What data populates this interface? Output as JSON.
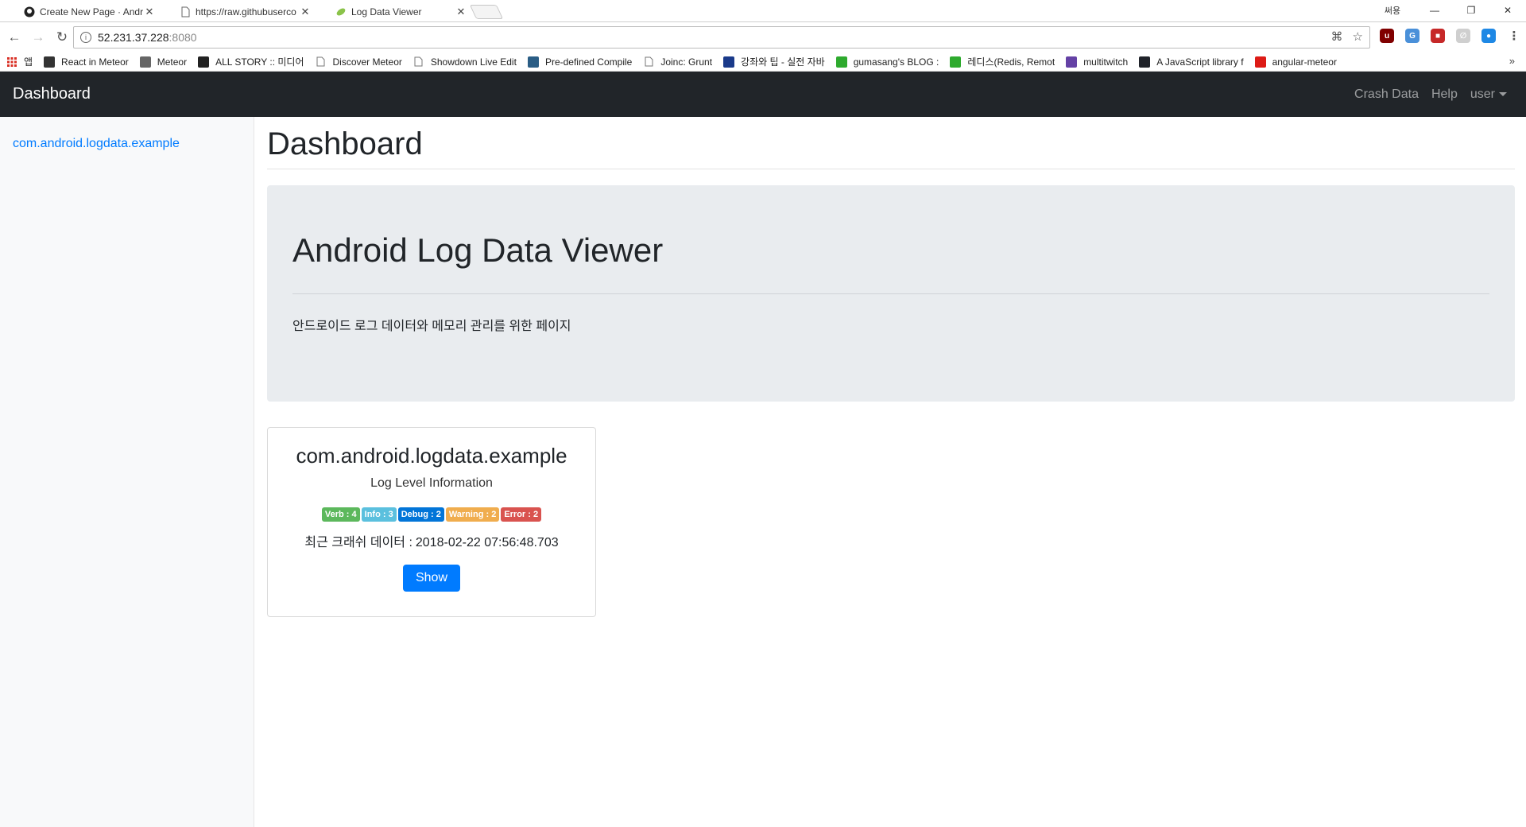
{
  "browser": {
    "tabs": [
      {
        "title": "Create New Page · Andr",
        "icon": "github-icon",
        "active": false
      },
      {
        "title": "https://raw.githubuserco",
        "icon": "page-icon",
        "active": false
      },
      {
        "title": "Log Data Viewer",
        "icon": "leaf-icon",
        "active": true
      }
    ],
    "profile_label": "써용",
    "url_host": "52.231.37.228",
    "url_port": ":8080",
    "bookmarks": [
      {
        "label": "앱",
        "icon": "apps-grid-icon",
        "color": "#d93025"
      },
      {
        "label": "React in Meteor",
        "icon": "book-icon",
        "color": "#333333"
      },
      {
        "label": "Meteor",
        "icon": "meteor-icon",
        "color": "#666666"
      },
      {
        "label": "ALL STORY :: 미디어",
        "icon": "circle-icon",
        "color": "#222222"
      },
      {
        "label": "Discover Meteor",
        "icon": "page-icon",
        "color": "#777777"
      },
      {
        "label": "Showdown Live Edit",
        "icon": "page-icon",
        "color": "#777777"
      },
      {
        "label": "Pre-defined Compile",
        "icon": "sf-icon",
        "color": "#2a5d85"
      },
      {
        "label": "Joinc: Grunt",
        "icon": "page-icon",
        "color": "#777777"
      },
      {
        "label": "강좌와 팁 - 실전 자바",
        "icon": "code-icon",
        "color": "#1a3a8a"
      },
      {
        "label": "gumasang's BLOG :",
        "icon": "blog-icon",
        "color": "#2eaa2e"
      },
      {
        "label": "레디스(Redis, Remot",
        "icon": "blog-icon",
        "color": "#2eaa2e"
      },
      {
        "label": "multitwitch",
        "icon": "twitch-icon",
        "color": "#6441a5"
      },
      {
        "label": "A JavaScript library f",
        "icon": "react-icon",
        "color": "#20232a"
      },
      {
        "label": "angular-meteor",
        "icon": "shield-icon",
        "color": "#dd1b16"
      }
    ]
  },
  "navbar": {
    "brand": "Dashboard",
    "links": [
      "Crash Data",
      "Help"
    ],
    "user": "user"
  },
  "sidebar": {
    "items": [
      "com.android.logdata.example"
    ]
  },
  "main": {
    "title": "Dashboard",
    "jumbotron": {
      "heading": "Android Log Data Viewer",
      "description": "안드로이드 로그 데이터와 메모리 관리를 위한 페이지"
    },
    "card": {
      "title": "com.android.logdata.example",
      "subtitle": "Log Level Information",
      "badges": [
        {
          "text": "Verb : 4",
          "color": "#5cb85c"
        },
        {
          "text": "Info : 3",
          "color": "#5bc0de"
        },
        {
          "text": "Debug : 2",
          "color": "#0275d8"
        },
        {
          "text": "Warning : 2",
          "color": "#f0ad4e"
        },
        {
          "text": "Error : 2",
          "color": "#d9534f"
        }
      ],
      "crash_label": "최근 크래쉬 데이터 :",
      "crash_time": "2018-02-22 07:56:48.703",
      "button": "Show"
    }
  }
}
